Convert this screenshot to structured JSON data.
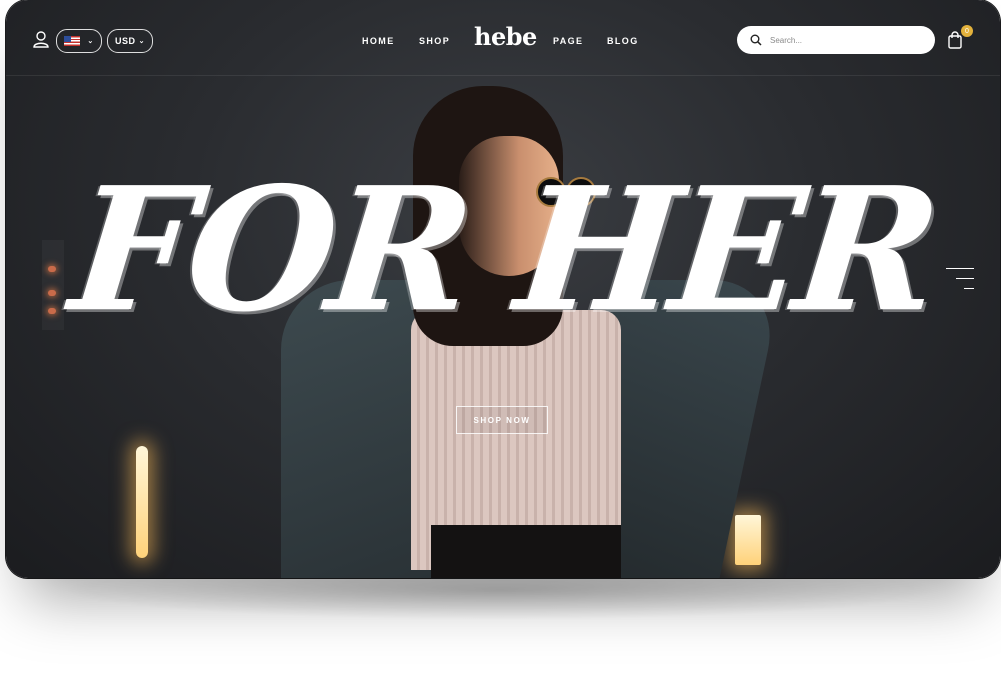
{
  "header": {
    "language_flag": "us-flag-icon",
    "currency": "USD",
    "nav": {
      "home": "HOME",
      "shop": "SHOP",
      "page": "PAGE",
      "blog": "BLOG"
    },
    "logo": "hebe",
    "search_placeholder": "Search...",
    "cart_count": "0"
  },
  "hero": {
    "title": "FOR HER",
    "cta_label": "SHOP NOW"
  },
  "icons": {
    "user": "user-icon",
    "search": "search-icon",
    "cart": "bag-icon",
    "slider": "slide-indicator-icon"
  },
  "colors": {
    "background": "#2a2c30",
    "accent_badge": "#e3b23c",
    "text": "#ffffff"
  }
}
